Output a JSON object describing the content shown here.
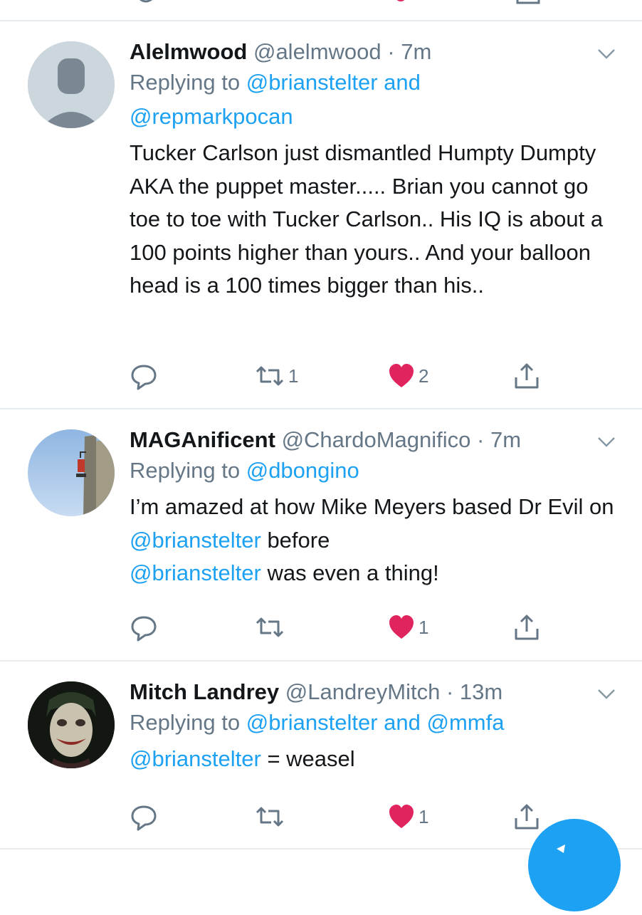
{
  "tweets": [
    {
      "name": "Alelmwood",
      "handle": "@alelmwood",
      "sep": " · ",
      "time": "7m",
      "replying_prefix": "Replying to ",
      "reply_parts": [
        "@brianstelter",
        " and",
        "@repmarkpocan"
      ],
      "text": "Tucker Carlson just dismantled Humpty Dumpty AKA the puppet master..... Brian you cannot go toe to toe with Tucker Carlson.. His IQ is about a 100 points higher than yours.. And your balloon head is a 100 times bigger than his..",
      "retweets": "1",
      "likes": "2",
      "avatar": "default-person-icon"
    },
    {
      "name": "MAGAnificent",
      "handle": "@ChardoMagnifico",
      "sep": " · ",
      "time": "7m",
      "replying_prefix": "Replying to ",
      "reply_parts": [
        "@dbongino"
      ],
      "text_parts": [
        "I’m amazed at how Mike Meyers based Dr Evil on ",
        "@brianstelter",
        " before ",
        "@brianstelter",
        " was even a thing!"
      ],
      "retweets": "",
      "likes": "1",
      "avatar": "sky-building-photo"
    },
    {
      "name": "Mitch Landrey",
      "handle": "@LandreyMitch",
      "sep": " · ",
      "time": "13m",
      "replying_prefix": "Replying to ",
      "reply_parts": [
        "@brianstelter",
        " and ",
        "@mmfa"
      ],
      "text_parts": [
        "@brianstelter",
        " = weasel"
      ],
      "retweets": "",
      "likes": "1",
      "avatar": "joker-face-photo"
    }
  ],
  "colors": {
    "link": "#1da1f2",
    "secondary": "#657786",
    "like": "#e0245e",
    "divider": "#e6ecf0"
  }
}
